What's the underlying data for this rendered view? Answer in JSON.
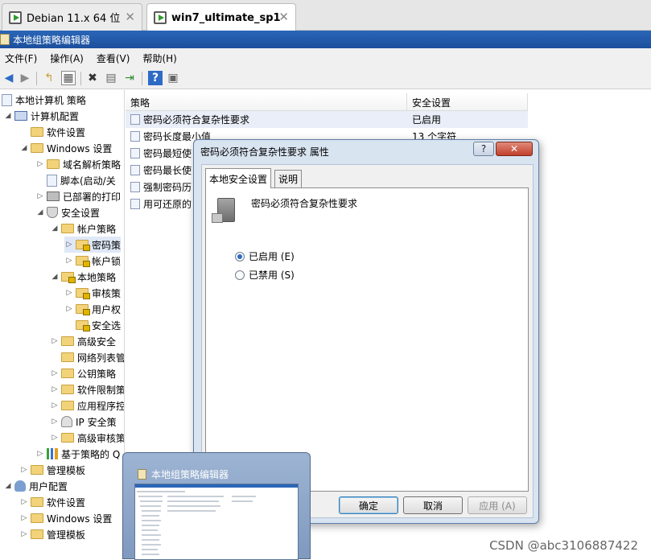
{
  "vm_tabs": [
    {
      "label": "Debian 11.x 64 位",
      "close": "✕",
      "icon": "vm-icon"
    },
    {
      "label": "win7_ultimate_sp1",
      "close": "✕",
      "icon": "vm-icon"
    }
  ],
  "window": {
    "title": "本地组策略编辑器"
  },
  "menu": [
    "文件(F)",
    "操作(A)",
    "查看(V)",
    "帮助(H)"
  ],
  "toolbar": {
    "back": "◀",
    "forward": "▶",
    "up": "↰",
    "show_hide": "▦",
    "delete": "✖",
    "properties": "▤",
    "export": "⇥",
    "help": "?",
    "console": "▣"
  },
  "tree": [
    {
      "label": "本地计算机 策略",
      "arrow": "",
      "icon": "doc"
    },
    {
      "label": "计算机配置",
      "arrow": "◢",
      "icon": "pc"
    },
    {
      "label": "软件设置",
      "arrow": "",
      "icon": "folder"
    },
    {
      "label": "Windows 设置",
      "arrow": "◢",
      "icon": "folder"
    },
    {
      "label": "域名解析策略",
      "arrow": "▷",
      "icon": "folder"
    },
    {
      "label": "脚本(启动/关",
      "arrow": "",
      "icon": "doc"
    },
    {
      "label": "已部署的打印",
      "arrow": "▷",
      "icon": "printer"
    },
    {
      "label": "安全设置",
      "arrow": "◢",
      "icon": "shield"
    },
    {
      "label": "帐户策略",
      "arrow": "◢",
      "icon": "folder"
    },
    {
      "label": "密码策",
      "arrow": "▷",
      "icon": "lockfolder"
    },
    {
      "label": "帐户锁",
      "arrow": "▷",
      "icon": "lockfolder"
    },
    {
      "label": "本地策略",
      "arrow": "◢",
      "icon": "lockfolder"
    },
    {
      "label": "审核策",
      "arrow": "▷",
      "icon": "lockfolder"
    },
    {
      "label": "用户权",
      "arrow": "▷",
      "icon": "lockfolder"
    },
    {
      "label": "安全选",
      "arrow": "",
      "icon": "lockfolder"
    },
    {
      "label": "高级安全",
      "arrow": "▷",
      "icon": "folder"
    },
    {
      "label": "网络列表管",
      "arrow": "",
      "icon": "folder"
    },
    {
      "label": "公钥策略",
      "arrow": "▷",
      "icon": "folder"
    },
    {
      "label": "软件限制策",
      "arrow": "▷",
      "icon": "folder"
    },
    {
      "label": "应用程序控",
      "arrow": "▷",
      "icon": "folder"
    },
    {
      "label": "IP 安全策",
      "arrow": "▷",
      "icon": "ip"
    },
    {
      "label": "高级审核策",
      "arrow": "▷",
      "icon": "folder"
    },
    {
      "label": "基于策略的 Q",
      "arrow": "▷",
      "icon": "bars"
    },
    {
      "label": "管理模板",
      "arrow": "▷",
      "icon": "folder"
    },
    {
      "label": "用户配置",
      "arrow": "◢",
      "icon": "user"
    },
    {
      "label": "软件设置",
      "arrow": "▷",
      "icon": "folder"
    },
    {
      "label": "Windows 设置",
      "arrow": "▷",
      "icon": "folder"
    },
    {
      "label": "管理模板",
      "arrow": "▷",
      "icon": "folder"
    }
  ],
  "list": {
    "columns": [
      "策略",
      "安全设置"
    ],
    "rows": [
      {
        "policy": "密码必须符合复杂性要求",
        "setting": "已启用"
      },
      {
        "policy": "密码长度最小值",
        "setting": "13 个字符"
      },
      {
        "policy": "密码最短使",
        "setting": ""
      },
      {
        "policy": "密码最长使",
        "setting": ""
      },
      {
        "policy": "强制密码历",
        "setting": ""
      },
      {
        "policy": "用可还原的",
        "setting": ""
      }
    ]
  },
  "dialog": {
    "title": "密码必须符合复杂性要求 属性",
    "help_btn": "?",
    "close_btn": "✕",
    "tabs": [
      "本地安全设置",
      "说明"
    ],
    "policy_name": "密码必须符合复杂性要求",
    "options": [
      {
        "label": "已启用 (E)",
        "checked": true
      },
      {
        "label": "已禁用 (S)",
        "checked": false
      }
    ],
    "buttons": {
      "ok": "确定",
      "cancel": "取消",
      "apply": "应用 (A)"
    }
  },
  "thumbnail": {
    "title": "本地组策略编辑器"
  },
  "watermark": "CSDN @abc3106887422"
}
